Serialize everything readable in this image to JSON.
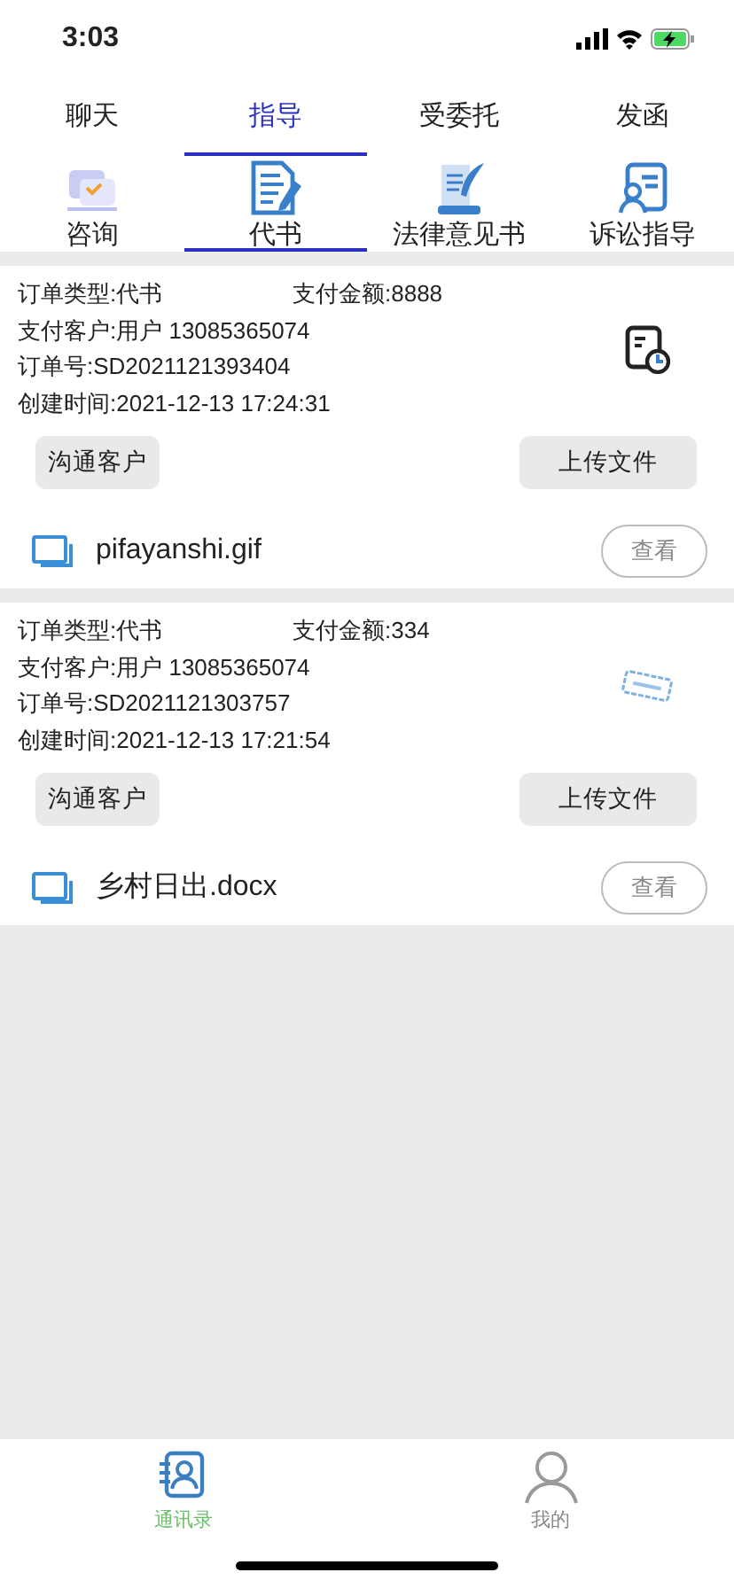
{
  "status_bar": {
    "time": "3:03"
  },
  "top_tabs": [
    {
      "label": "聊天",
      "selected": false
    },
    {
      "label": "指导",
      "selected": true
    },
    {
      "label": "受委托",
      "selected": false
    },
    {
      "label": "发函",
      "selected": false
    }
  ],
  "sub_tabs": [
    {
      "label": "咨询",
      "kind": "consult",
      "selected": false
    },
    {
      "label": "代书",
      "kind": "document",
      "selected": true
    },
    {
      "label": "法律意见书",
      "kind": "scroll",
      "selected": false
    },
    {
      "label": "诉讼指导",
      "kind": "litigation",
      "selected": false
    }
  ],
  "orders": [
    {
      "order_type": "订单类型:代书",
      "amount": "支付金额:8888",
      "customer": "支付客户:用户 13085365074",
      "order_no": "订单号:SD2021121393404",
      "created": "创建时间:2021-12-13 17:24:31",
      "kind": "pending",
      "contact_button": "沟通客户",
      "upload_button": "上传文件",
      "file_name": "pifayanshi.gif",
      "view_button": "查看"
    },
    {
      "order_type": "订单类型:代书",
      "amount": "支付金额:334",
      "customer": "支付客户:用户 13085365074",
      "order_no": "订单号:SD2021121303757",
      "created": "创建时间:2021-12-13 17:21:54",
      "kind": "stamp",
      "contact_button": "沟通客户",
      "upload_button": "上传文件",
      "file_name": "乡村日出.docx",
      "view_button": "查看"
    }
  ],
  "bottom_nav": [
    {
      "label": "通讯录",
      "kind": "contacts",
      "selected": true
    },
    {
      "label": "我的",
      "kind": "profile",
      "selected": false
    }
  ]
}
